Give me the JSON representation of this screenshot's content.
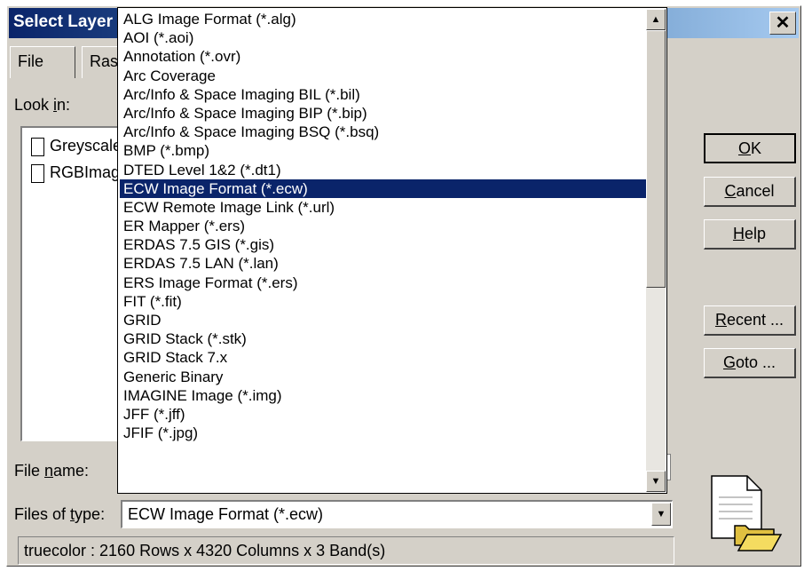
{
  "window": {
    "title": "Select Layer To Add",
    "close_glyph": "✕"
  },
  "tabs": {
    "file": "File",
    "raster": "Raster Options"
  },
  "look_in": {
    "label_pre": "Look ",
    "label_accel": "i",
    "label_post": "n:"
  },
  "files": [
    {
      "name": "Greyscale"
    },
    {
      "name": "RGBImage"
    }
  ],
  "buttons": {
    "ok": {
      "accel": "O",
      "rest": "K"
    },
    "cancel": {
      "accel": "C",
      "rest": "ancel"
    },
    "help": {
      "accel": "H",
      "rest": "elp"
    },
    "recent": {
      "accel": "R",
      "rest": "ecent ..."
    },
    "goto": {
      "accel": "G",
      "rest": "oto ..."
    }
  },
  "file_name": {
    "label_pre": "File ",
    "label_accel": "n",
    "label_post": "ame:",
    "value": ""
  },
  "files_of_type": {
    "label_pre": "Files of ",
    "label_accel": "t",
    "label_post": "ype:",
    "value": "ECW Image Format (*.ecw)"
  },
  "status_text": "truecolor : 2160 Rows x 4320 Columns x 3 Band(s)",
  "dropdown": {
    "selected_index": 10,
    "items": [
      "ALG Image Format (*.alg)",
      "AOI (*.aoi)",
      "Annotation (*.ovr)",
      "Arc Coverage",
      "Arc/Info & Space Imaging BIL (*.bil)",
      "Arc/Info & Space Imaging BIP (*.bip)",
      "Arc/Info & Space Imaging BSQ (*.bsq)",
      "BMP (*.bmp)",
      "DTED Level 1&2 (*.dt1)",
      "ECW Image Format (*.ecw)",
      "ECW Remote Image Link (*.url)",
      "ER Mapper (*.ers)",
      "ERDAS 7.5 GIS (*.gis)",
      "ERDAS 7.5 LAN (*.lan)",
      "ERS Image Format (*.ers)",
      "FIT (*.fit)",
      "GRID",
      "GRID Stack (*.stk)",
      "GRID Stack 7.x",
      "Generic Binary",
      "IMAGINE Image (*.img)",
      "JFF (*.jff)",
      "JFIF (*.jpg)"
    ]
  },
  "icons": {
    "scroll_up": "▲",
    "scroll_down": "▼",
    "combo_arrow": "▼"
  }
}
